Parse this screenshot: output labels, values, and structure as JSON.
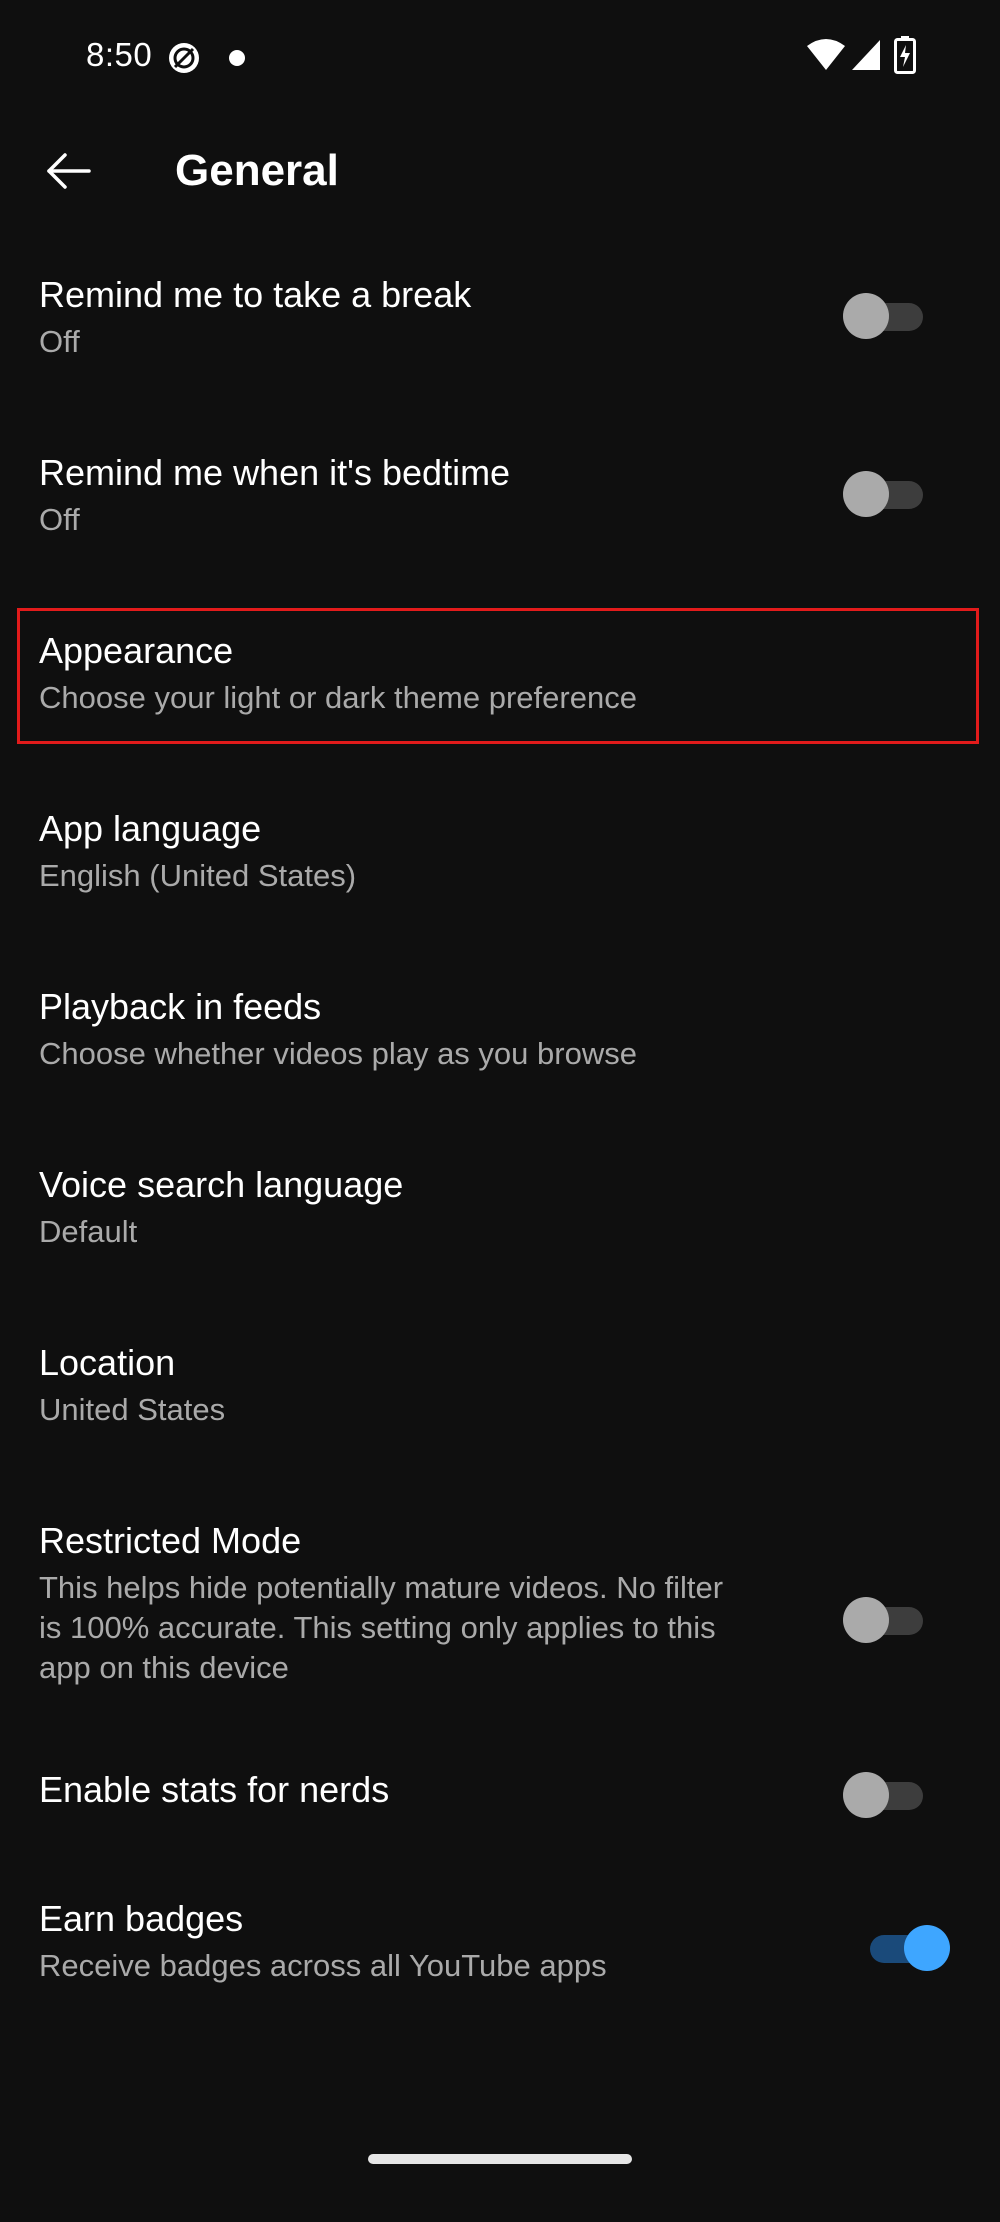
{
  "status_bar": {
    "time": "8:50",
    "icons": [
      "vpn-icon",
      "notification-dot-icon",
      "wifi-icon",
      "cell-signal-icon",
      "battery-charging-icon"
    ]
  },
  "app_bar": {
    "back_icon": "arrow-left-icon",
    "title": "General"
  },
  "settings": [
    {
      "title": "Remind me to take a break",
      "subtitle": "Off",
      "toggle": "off"
    },
    {
      "title": "Remind me when it's bedtime",
      "subtitle": "Off",
      "toggle": "off"
    },
    {
      "title": "Appearance",
      "subtitle": "Choose your light or dark theme preference",
      "highlighted": true
    },
    {
      "title": "App language",
      "subtitle": "English (United States)"
    },
    {
      "title": "Playback in feeds",
      "subtitle": "Choose whether videos play as you browse"
    },
    {
      "title": "Voice search language",
      "subtitle": "Default"
    },
    {
      "title": "Location",
      "subtitle": "United States"
    },
    {
      "title": "Restricted Mode",
      "subtitle_lines": [
        "This helps hide potentially mature videos. No filter",
        "is 100% accurate. This setting only applies to this",
        "app on this device"
      ],
      "toggle": "off"
    },
    {
      "title": "Enable stats for nerds",
      "toggle": "off"
    },
    {
      "title": "Earn badges",
      "subtitle": "Receive badges across all YouTube apps",
      "toggle": "on"
    }
  ],
  "colors": {
    "background": "#0f0f0f",
    "text_primary": "#ffffff",
    "text_secondary": "#aaaaaa",
    "toggle_on": "#3ea6ff",
    "highlight": "#e21b1b"
  }
}
